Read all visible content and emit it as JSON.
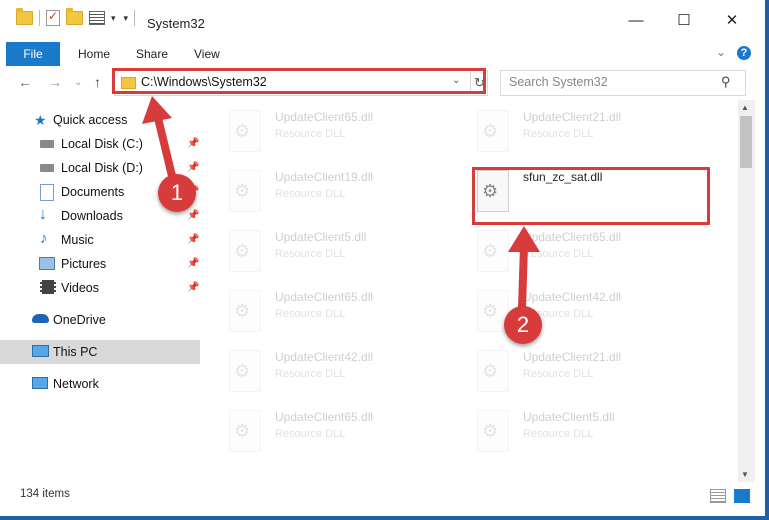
{
  "window": {
    "title": "System32",
    "minimize": "—",
    "maximize": "☐",
    "close": "✕"
  },
  "ribbon": {
    "tabs": [
      "File",
      "Home",
      "Share",
      "View"
    ],
    "help": "?",
    "expand": "⌄"
  },
  "nav": {
    "back": "←",
    "forward": "→",
    "recent": "⌄",
    "up": "↑",
    "address": "C:\\Windows\\System32",
    "refresh": "↻",
    "dropdown": "⌄",
    "search_placeholder": "Search System32",
    "search_icon": "⚲"
  },
  "sidebar": {
    "items": [
      {
        "label": "Quick access",
        "icon": "star-icon",
        "pinned": false
      },
      {
        "label": "Local Disk (C:)",
        "icon": "drive-icon",
        "pinned": true
      },
      {
        "label": "Local Disk (D:)",
        "icon": "drive-icon",
        "pinned": true
      },
      {
        "label": "Documents",
        "icon": "documents-icon",
        "pinned": true
      },
      {
        "label": "Downloads",
        "icon": "download-icon",
        "pinned": true
      },
      {
        "label": "Music",
        "icon": "music-icon",
        "pinned": true
      },
      {
        "label": "Pictures",
        "icon": "pictures-icon",
        "pinned": true
      },
      {
        "label": "Videos",
        "icon": "videos-icon",
        "pinned": true
      },
      {
        "label": "OneDrive",
        "icon": "cloud-icon",
        "pinned": false
      },
      {
        "label": "This PC",
        "icon": "computer-icon",
        "pinned": false,
        "selected": true
      },
      {
        "label": "Network",
        "icon": "network-icon",
        "pinned": false
      }
    ],
    "pin_glyph": "📌"
  },
  "files": {
    "left": [
      {
        "name": "UpdateClient65.dll",
        "type": "Resource DLL"
      },
      {
        "name": "UpdateClient19.dll",
        "type": "Resource DLL"
      },
      {
        "name": "UpdateClient5.dll",
        "type": "Resource DLL"
      },
      {
        "name": "UpdateClient65.dll",
        "type": "Resource DLL"
      },
      {
        "name": "UpdateClient42.dll",
        "type": "Resource DLL"
      },
      {
        "name": "UpdateClient65.dll",
        "type": "Resource DLL"
      }
    ],
    "right": [
      {
        "name": "UpdateClient21.dll",
        "type": "Resource DLL",
        "faded": true
      },
      {
        "name": "sfun_zc_sat.dll",
        "type": "",
        "faded": false
      },
      {
        "name": "UpdateClient65.dll",
        "type": "Resource DLL",
        "faded": true
      },
      {
        "name": "UpdateClient42.dll",
        "type": "Resource DLL",
        "faded": true
      },
      {
        "name": "UpdateClient21.dll",
        "type": "Resource DLL",
        "faded": true
      },
      {
        "name": "UpdateClient5.dll",
        "type": "Resource DLL",
        "faded": true
      }
    ]
  },
  "annotations": {
    "step1": "1",
    "step2": "2",
    "color": "#d83b3b"
  },
  "status": {
    "count": "134 items"
  }
}
